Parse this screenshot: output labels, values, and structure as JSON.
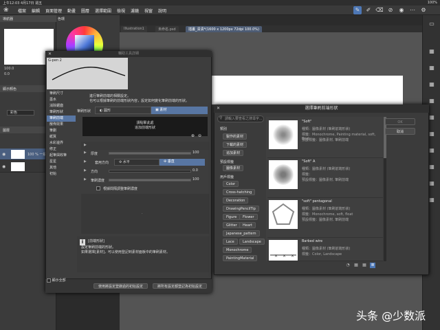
{
  "status": {
    "time_date": "上午12:03 4月17日 週五",
    "battery": "100%"
  },
  "app": {
    "icon": "clip-studio-icon"
  },
  "menu": [
    "檔案",
    "編輯",
    "頁面管理",
    "動畫",
    "圖層",
    "選擇範圍",
    "檢視",
    "濾鏡",
    "視窗",
    "說明"
  ],
  "tabs": [
    "Illustration1",
    "未命名.psd",
    "插畫_清清*(1600 x 1200px 72dpi 100.0%)"
  ],
  "left": {
    "navigator_title": "導航器",
    "zoom": "100.0",
    "angle": "0.0",
    "layer_panel_title": "圖層",
    "color_label": "顯示顏色",
    "color_value": "彩色",
    "layers": [
      {
        "name": "100 % 一般"
      },
      {
        "name": ""
      },
      {
        "name": ""
      }
    ]
  },
  "color_panel": {
    "title": "色環"
  },
  "brush_dialog": {
    "title": "輔助工具詳細",
    "preview_label": "G-pen 2",
    "description": [
      "進行筆刷前端的相關設定。",
      "也可以根據筆刷的前端形狀內容，設定如何變化筆刷前端的形狀。"
    ],
    "categories": [
      "筆刷尺寸",
      "墨水",
      "消除鋸齒",
      "筆刷形狀",
      "筆刷前端",
      "散佈效果",
      "筆劃",
      "紙質",
      "水彩邊界",
      "修正",
      "起筆與收筆",
      "星星",
      "其他",
      "初始"
    ],
    "selected_category_index": 4,
    "shape_label": "筆刷形狀",
    "shape_circle": "圓形",
    "shape_material": "素材",
    "hint": [
      "請點擊此處",
      "追加前端形狀"
    ],
    "props": [
      {
        "label": "厚度",
        "value": "100"
      },
      {
        "label": "套用方向",
        "value": ""
      },
      {
        "label": "方向",
        "value": "0.0"
      },
      {
        "label": "筆刷濃度",
        "value": "100"
      }
    ],
    "dir_horizontal": "水平",
    "dir_vertical": "垂直",
    "checkbox": "根據間隔調整筆刷濃度",
    "info_title": "[前端形狀]",
    "info_lines": [
      "設定筆刷前端的形狀。",
      "如果選擇[素材]，可以使用登記到素材面板中的筆刷素材。"
    ],
    "show_all": "顯示全部",
    "btn_save": "使用將設定登錄過的初始設定",
    "btn_reset": "將所有設定都登記為初始設定"
  },
  "select_dialog": {
    "title": "選擇筆刷前端形狀",
    "search_placeholder": "請輸入要查看之搜尋字...",
    "tree_category": "類別",
    "tree_items_a": [
      "製作的素材",
      "下載的素材",
      "追加素材"
    ],
    "tree_preset": "預設標籤",
    "tree_items_b": [
      "圖像素材"
    ],
    "tree_user": "用戶標籤",
    "tags": [
      "Color",
      "Cross-hatching",
      "Decoration",
      "DrawingPencilTip",
      "Figure",
      "Flower",
      "Glitter",
      "Heart",
      "Japanese_pattern",
      "Lace",
      "Landscape",
      "Monochrome",
      "PaintingMaterial"
    ],
    "materials": [
      {
        "name": "\"Soft\"",
        "line1": "種類：圖像素材 (筆刷前端形狀)",
        "line2": "標籤：Monochrome, Painting material, soft, float",
        "line3": "預設標籤：圖像素材, 筆刷前端"
      },
      {
        "name": "\"Soft\" A",
        "line1": "種類：圖像素材 (筆刷前端形狀)",
        "line2": "標籤：",
        "line3": "預設標籤：圖像素材, 筆刷前端"
      },
      {
        "name": "\"soft\" pentagonal",
        "line1": "種類：圖像素材 (筆刷前端形狀)",
        "line2": "標籤：Monochrome, soft, float",
        "line3": "預設標籤：圖像素材, 筆刷前端"
      },
      {
        "name": "Barbed wire",
        "line1": "種類：圖像素材 (筆刷前端形狀)",
        "line2": "標籤：Color, Landscape",
        "line3": "預設標籤：圖像素材, 筆刷前端"
      }
    ],
    "ok": "OK",
    "cancel": "取消"
  },
  "watermark": "头条 @少数派"
}
